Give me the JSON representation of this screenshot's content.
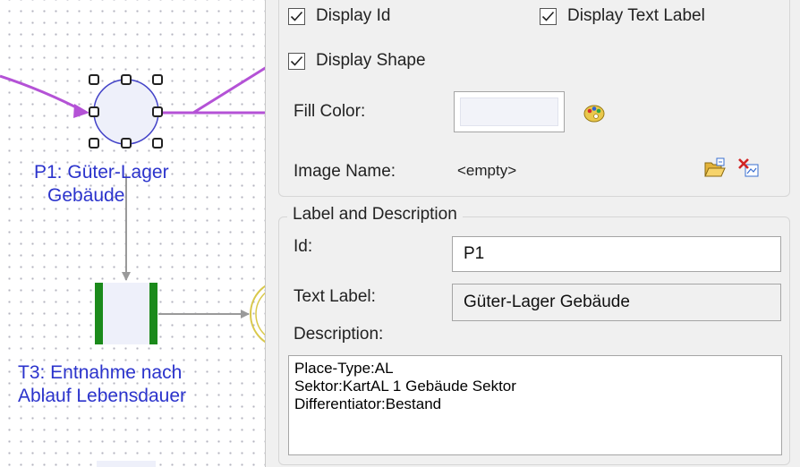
{
  "canvas": {
    "place_label_line1": "P1: Güter-Lager",
    "place_label_line2": "Gebäude",
    "transition_label_line1": "T3: Entnahme nach",
    "transition_label_line2": "Ablauf Lebensdauer"
  },
  "display": {
    "display_id": {
      "label": "Display Id",
      "checked": true
    },
    "display_text_label": {
      "label": "Display Text Label",
      "checked": true
    },
    "display_shape": {
      "label": "Display Shape",
      "checked": true
    },
    "fill_color_label": "Fill Color:",
    "fill_color_value": "#f2f3f9",
    "image_name_label": "Image Name:",
    "image_name_value": "<empty>",
    "icons": [
      "color-palette-icon",
      "open-folder-icon",
      "clear-image-icon"
    ]
  },
  "label_desc": {
    "group_title": "Label and Description",
    "id_label": "Id:",
    "id_value": "P1",
    "text_label_label": "Text Label:",
    "text_label_value": "Güter-Lager  Gebäude",
    "description_label": "Description:",
    "description_lines": [
      "Place-Type:AL",
      "Sektor:KartAL 1 Gebäude Sektor",
      "Differentiator:Bestand"
    ]
  },
  "colors": {
    "arc": "#b452d6",
    "place_stroke": "#4343c8",
    "transition": "#1b8a1b",
    "label_text": "#2b33cc"
  }
}
